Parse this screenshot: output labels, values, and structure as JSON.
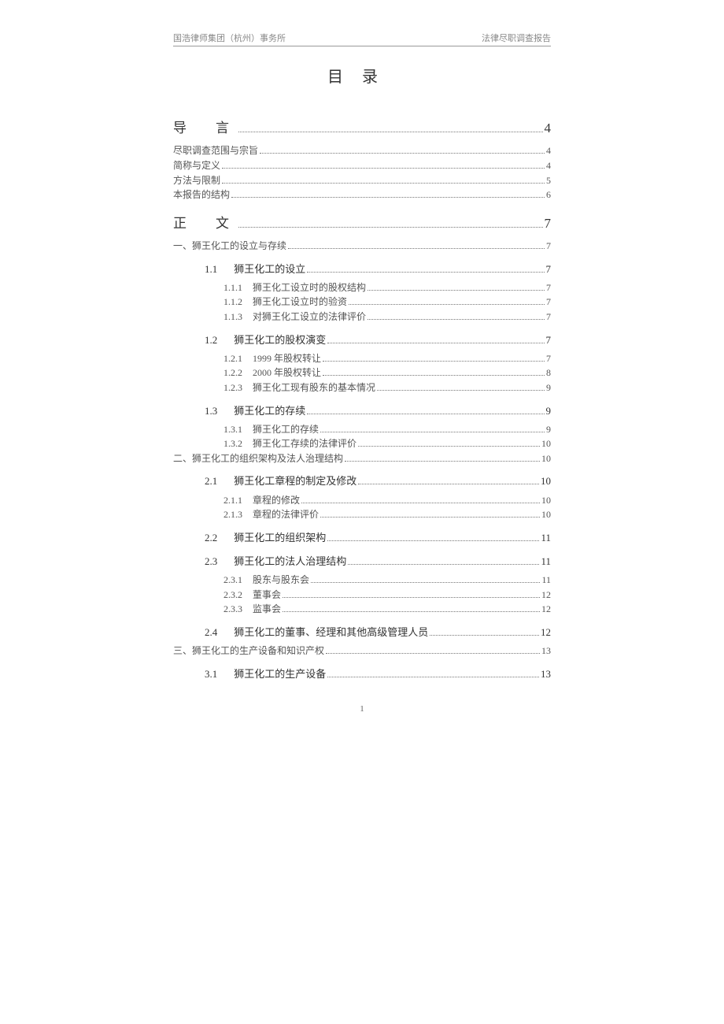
{
  "header": {
    "left": "国浩律师集团（杭州）事务所",
    "right": "法律尽职调查报告"
  },
  "title": "目录",
  "toc": [
    {
      "level": "big",
      "label": "导　言",
      "page": "4"
    },
    {
      "level": "lvl0",
      "label": "尽职调查范围与宗旨",
      "page": "4"
    },
    {
      "level": "lvl0",
      "label": "简称与定义",
      "page": "4"
    },
    {
      "level": "lvl0",
      "label": "方法与限制",
      "page": "5"
    },
    {
      "level": "lvl0",
      "label": "本报告的结构",
      "page": "6"
    },
    {
      "level": "big",
      "label": "正　文",
      "page": "7"
    },
    {
      "level": "lvl1",
      "label": "一、狮王化工的设立与存续",
      "page": "7"
    },
    {
      "level": "lvl2 section-head",
      "num": "1.1",
      "label": "狮王化工的设立",
      "page": "7"
    },
    {
      "level": "lvl3",
      "num": "1.1.1",
      "label": "狮王化工设立时的股权结构",
      "page": "7"
    },
    {
      "level": "lvl3",
      "num": "1.1.2",
      "label": "狮王化工设立时的验资",
      "page": "7"
    },
    {
      "level": "lvl3",
      "num": "1.1.3",
      "label": "对狮王化工设立的法律评价",
      "page": "7"
    },
    {
      "level": "lvl2 section-head",
      "num": "1.2",
      "label": "狮王化工的股权演变",
      "page": "7"
    },
    {
      "level": "lvl3",
      "num": "1.2.1",
      "label": "1999 年股权转让",
      "page": "7"
    },
    {
      "level": "lvl3",
      "num": "1.2.2",
      "label": "2000 年股权转让",
      "page": "8"
    },
    {
      "level": "lvl3",
      "num": "1.2.3",
      "label": "狮王化工现有股东的基本情况",
      "page": "9"
    },
    {
      "level": "lvl2 section-head",
      "num": "1.3",
      "label": "狮王化工的存续",
      "page": "9"
    },
    {
      "level": "lvl3",
      "num": "1.3.1",
      "label": "狮王化工的存续",
      "page": "9"
    },
    {
      "level": "lvl3",
      "num": "1.3.2",
      "label": "狮王化工存续的法律评价",
      "page": "10"
    },
    {
      "level": "lvl1",
      "label": "二、狮王化工的组织架构及法人治理结构",
      "page": "10"
    },
    {
      "level": "lvl2 section-head",
      "num": "2.1",
      "label": "狮王化工章程的制定及修改",
      "page": "10"
    },
    {
      "level": "lvl3",
      "num": "2.1.1",
      "label": "章程的修改",
      "page": "10"
    },
    {
      "level": "lvl3",
      "num": "2.1.3",
      "label": "章程的法律评价",
      "page": "10"
    },
    {
      "level": "lvl2 section-head",
      "num": "2.2",
      "label": "狮王化工的组织架构",
      "page": "11"
    },
    {
      "level": "lvl2 section-head",
      "num": "2.3",
      "label": "狮王化工的法人治理结构",
      "page": "11"
    },
    {
      "level": "lvl3",
      "num": "2.3.1",
      "label": "股东与股东会",
      "page": "11"
    },
    {
      "level": "lvl3",
      "num": "2.3.2",
      "label": "董事会",
      "page": "12"
    },
    {
      "level": "lvl3",
      "num": "2.3.3",
      "label": "监事会",
      "page": "12"
    },
    {
      "level": "lvl2 section-head",
      "num": "2.4",
      "label": "狮王化工的董事、经理和其他高级管理人员",
      "page": "12"
    },
    {
      "level": "lvl1",
      "label": "三、狮王化工的生产设备和知识产权",
      "page": "13"
    },
    {
      "level": "lvl2 section-head",
      "num": "3.1",
      "label": "狮王化工的生产设备",
      "page": "13"
    }
  ],
  "footer_page": "1"
}
